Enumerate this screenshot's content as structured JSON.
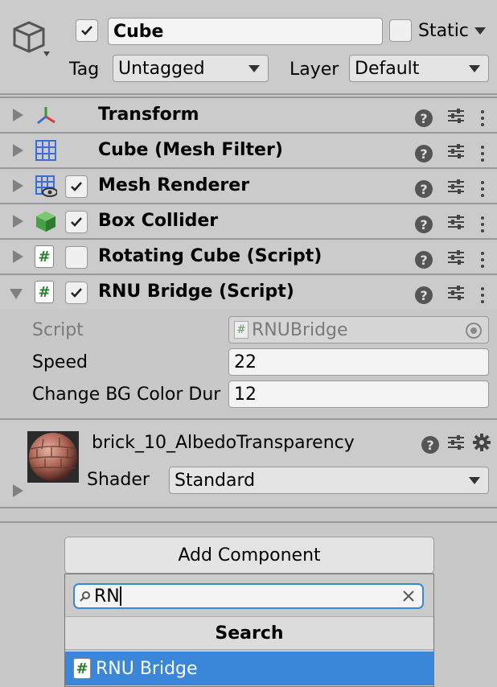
{
  "header": {
    "object_name": "Cube",
    "static_label": "Static",
    "tag_label": "Tag",
    "tag_value": "Untagged",
    "layer_label": "Layer",
    "layer_value": "Default"
  },
  "components": [
    {
      "title": "Transform",
      "icon": "transform-icon",
      "checkbox": null
    },
    {
      "title": "Cube (Mesh Filter)",
      "icon": "mesh-filter-icon",
      "checkbox": null
    },
    {
      "title": "Mesh Renderer",
      "icon": "mesh-renderer-icon",
      "checkbox": true
    },
    {
      "title": "Box Collider",
      "icon": "box-collider-icon",
      "checkbox": true
    },
    {
      "title": "Rotating Cube (Script)",
      "icon": "script-icon",
      "checkbox": false
    },
    {
      "title": "RNU Bridge (Script)",
      "icon": "script-icon",
      "checkbox": true
    }
  ],
  "rnu_bridge": {
    "script_label": "Script",
    "script_value": "RNUBridge",
    "speed_label": "Speed",
    "speed_value": "22",
    "bg_label": "Change BG Color Dur",
    "bg_value": "12"
  },
  "material": {
    "name": "brick_10_AlbedoTransparency",
    "shader_label": "Shader",
    "shader_value": "Standard"
  },
  "add_component": {
    "button_label": "Add Component",
    "search_value": "RN",
    "search_header": "Search",
    "result": "RNU Bridge"
  },
  "colors": {
    "selection": "#3a86d8",
    "script_green": "#2e7d32"
  }
}
